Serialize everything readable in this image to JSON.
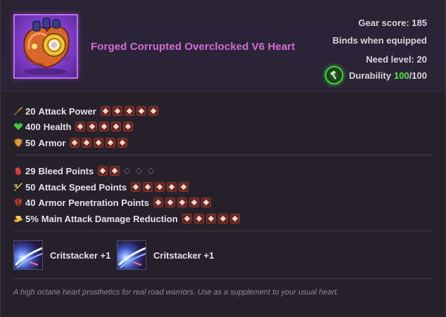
{
  "item": {
    "name": "Forged Corrupted Overclocked V6 Heart",
    "rarity_color": "#d66bd8",
    "icon": "mechanical-heart-icon"
  },
  "meta": {
    "gear_score": "Gear score: 185",
    "binds": "Binds when equipped",
    "need_level": "Need level: 20",
    "durability_label": "Durability",
    "durability_current": "100",
    "durability_max": "/100",
    "durability_icon": "repair-hammer-icon"
  },
  "base_stats": [
    {
      "value": "20",
      "name": "Attack Power",
      "icon": "sword-icon",
      "gems_filled": 5,
      "gems_total": 5
    },
    {
      "value": "400",
      "name": "Health",
      "icon": "heart-icon",
      "gems_filled": 5,
      "gems_total": 5
    },
    {
      "value": "50",
      "name": "Armor",
      "icon": "shield-icon",
      "gems_filled": 5,
      "gems_total": 5
    }
  ],
  "bonus_stats": [
    {
      "value": "29",
      "name": "Bleed Points",
      "icon": "blood-drop-icon",
      "gems_filled": 2,
      "gems_total": 5
    },
    {
      "value": "50",
      "name": "Attack Speed Points",
      "icon": "lightning-sword-icon",
      "gems_filled": 5,
      "gems_total": 5
    },
    {
      "value": "40",
      "name": "Armor Penetration Points",
      "icon": "broken-shield-icon",
      "gems_filled": 5,
      "gems_total": 5
    },
    {
      "value": "5%",
      "name": "Main Attack Damage Reduction",
      "icon": "gold-coins-icon",
      "gems_filled": 5,
      "gems_total": 5
    }
  ],
  "perks": [
    {
      "label": "Critstacker +1",
      "icon": "critstacker-icon"
    },
    {
      "label": "Critstacker +1",
      "icon": "critstacker-icon"
    }
  ],
  "description": "A high octane heart prosthetics for real road warriors. Use as a supplement to your usual heart.",
  "colors": {
    "background": "#25222c",
    "durability_green": "#5fe04c",
    "gem": "#6a2420"
  }
}
